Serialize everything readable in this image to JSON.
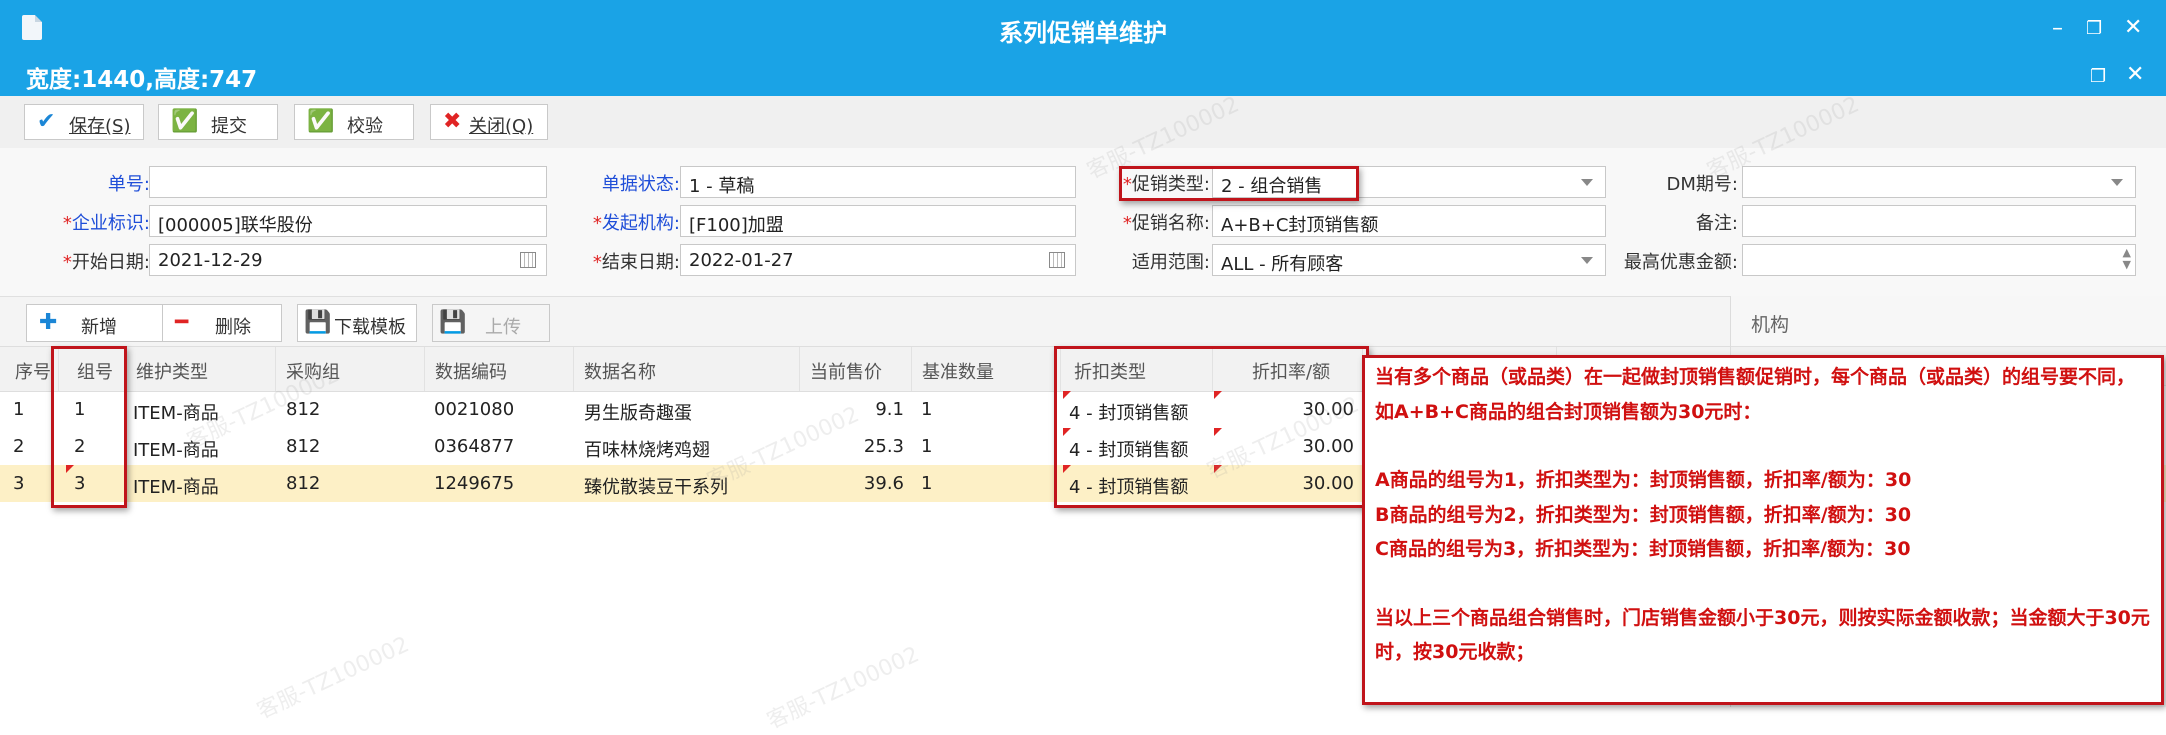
{
  "window": {
    "title": "系列促销单维护",
    "size_info": "宽度:1440,高度:747"
  },
  "toolbar": {
    "save": "保存(S)",
    "submit": "提交",
    "check": "校验",
    "close": "关闭(Q)"
  },
  "form": {
    "doc_no": {
      "label": "单号:",
      "value": ""
    },
    "doc_status": {
      "label": "单据状态:",
      "value": "1 - 草稿"
    },
    "promo_type": {
      "label": "促销类型:",
      "value": "2 - 组合销售"
    },
    "dm_period": {
      "label": "DM期号:",
      "value": ""
    },
    "company": {
      "label": "企业标识:",
      "value": "[000005]联华股份"
    },
    "origin_org": {
      "label": "发起机构:",
      "value": "[F100]加盟"
    },
    "promo_name": {
      "label": "促销名称:",
      "value": "A+B+C封顶销售额"
    },
    "remark": {
      "label": "备注:",
      "value": ""
    },
    "start_date": {
      "label": "开始日期:",
      "value": "2021-12-29"
    },
    "end_date": {
      "label": "结束日期:",
      "value": "2022-01-27"
    },
    "scope": {
      "label": "适用范围:",
      "value": "ALL - 所有顾客"
    },
    "max_discount": {
      "label": "最高优惠金额:",
      "value": ""
    }
  },
  "gridbar": {
    "add": "新增",
    "delete": "删除",
    "download": "下载模板",
    "upload": "上传"
  },
  "org_panel": {
    "title": "机构"
  },
  "table": {
    "headers": {
      "seq": "序号",
      "group": "组号",
      "maint_type": "维护类型",
      "purchase_group": "采购组",
      "data_code": "数据编码",
      "data_name": "数据名称",
      "price": "当前售价",
      "base_qty": "基准数量",
      "discount_type": "折扣类型",
      "discount_rate": "折扣率/额"
    },
    "rows": [
      {
        "seq": "1",
        "group": "1",
        "maint_type": "ITEM-商品",
        "purchase_group": "812",
        "data_code": "0021080",
        "data_name": "男生版奇趣蛋",
        "price": "9.1",
        "base_qty": "1",
        "discount_type": "4 - 封顶销售额",
        "discount_rate": "30.00"
      },
      {
        "seq": "2",
        "group": "2",
        "maint_type": "ITEM-商品",
        "purchase_group": "812",
        "data_code": "0364877",
        "data_name": "百味林烧烤鸡翅",
        "price": "25.3",
        "base_qty": "1",
        "discount_type": "4 - 封顶销售额",
        "discount_rate": "30.00"
      },
      {
        "seq": "3",
        "group": "3",
        "maint_type": "ITEM-商品",
        "purchase_group": "812",
        "data_code": "1249675",
        "data_name": "臻优散装豆干系列",
        "price": "39.6",
        "base_qty": "1",
        "discount_type": "4 - 封顶销售额",
        "discount_rate": "30.00"
      }
    ],
    "selected_row_color": "#fdf0c6"
  },
  "annotation": {
    "p1": "当有多个商品（或品类）在一起做封顶销售额促销时，每个商品（或品类）的组号要不同，如A+B+C商品的组合封顶销售额为30元时：",
    "p2": "A商品的组号为1，折扣类型为：封顶销售额，折扣率/额为：30",
    "p3": "B商品的组号为2，折扣类型为：封顶销售额，折扣率/额为：30",
    "p4": "C商品的组号为3，折扣类型为：封顶销售额，折扣率/额为：30",
    "p5": "当以上三个商品组合销售时，门店销售金额小于30元，则按实际金额收款；当金额大于30元时，按30元收款；"
  },
  "watermark": "客服-TZ100002",
  "colors": {
    "titlebar": "#1aa3e6",
    "highlight_red": "#c0141b",
    "annotation_text": "#d01010",
    "label_blue": "#1f4ed8"
  }
}
